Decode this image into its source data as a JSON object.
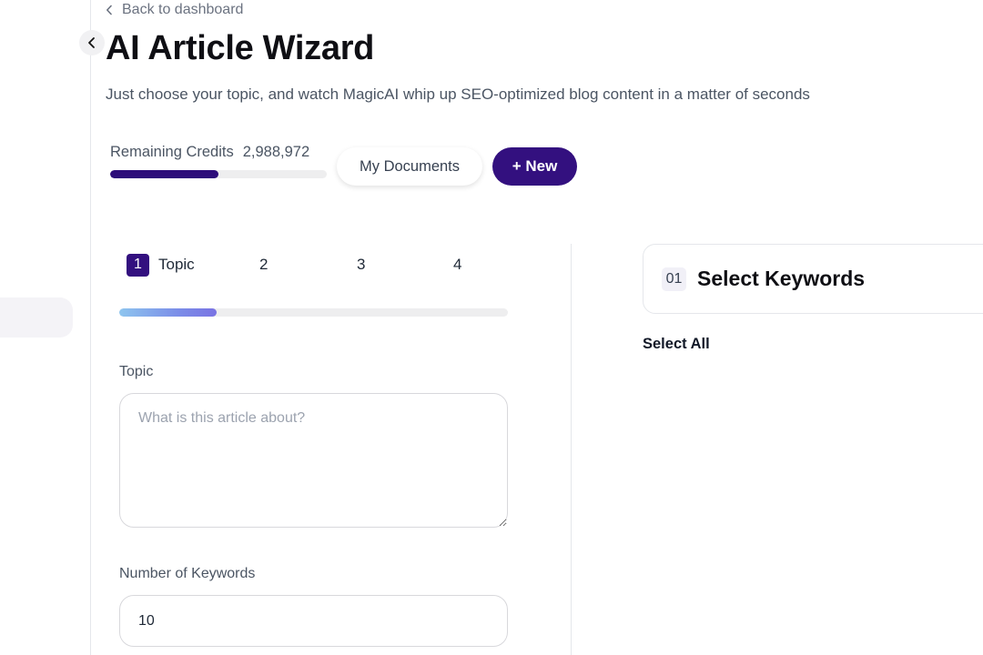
{
  "nav": {
    "back_label": "Back to dashboard"
  },
  "header": {
    "title": "AI Article Wizard",
    "subtitle": "Just choose your topic, and watch MagicAI whip up SEO-optimized blog content in a matter of seconds"
  },
  "credits": {
    "label": "Remaining Credits",
    "value": "2,988,972",
    "fill_percent": 50
  },
  "actions": {
    "documents_label": "My Documents",
    "new_label": "+ New"
  },
  "wizard": {
    "steps": [
      {
        "number": "1",
        "label": "Topic",
        "active": true
      },
      {
        "number": "2",
        "label": "",
        "active": false
      },
      {
        "number": "3",
        "label": "",
        "active": false
      },
      {
        "number": "4",
        "label": "",
        "active": false
      }
    ],
    "progress_percent": 25
  },
  "form": {
    "topic_label": "Topic",
    "topic_placeholder": "What is this article about?",
    "topic_value": "",
    "keywords_label": "Number of Keywords",
    "keywords_value": "10"
  },
  "keywords_panel": {
    "badge": "01",
    "title": "Select Keywords",
    "select_all_label": "Select All"
  },
  "colors": {
    "brand": "#33107f",
    "progress_start": "#8ec5ef",
    "progress_end": "#7a73e3"
  }
}
